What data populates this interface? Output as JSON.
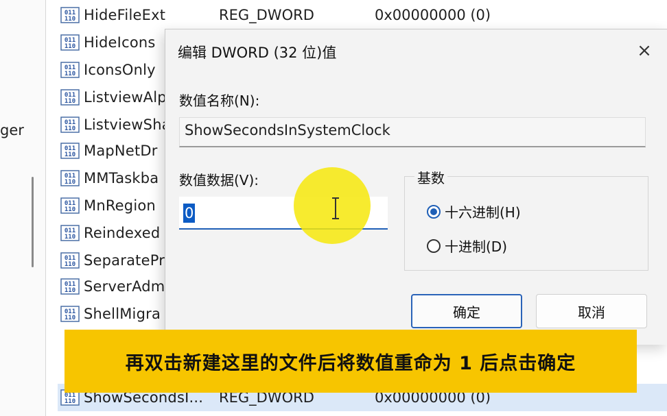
{
  "tree": {
    "fragment": "ger"
  },
  "values": [
    {
      "name": "HideFileExt",
      "type": "REG_DWORD",
      "data": "0x00000000 (0)"
    },
    {
      "name": "HideIcons",
      "type": "",
      "data": ""
    },
    {
      "name": "IconsOnly",
      "type": "",
      "data": ""
    },
    {
      "name": "ListviewAlp",
      "type": "",
      "data": ""
    },
    {
      "name": "ListviewSha",
      "type": "",
      "data": ""
    },
    {
      "name": "MapNetDr",
      "type": "",
      "data": ""
    },
    {
      "name": "MMTaskba",
      "type": "",
      "data": ""
    },
    {
      "name": "MnRegion",
      "type": "",
      "data": ""
    },
    {
      "name": "Reindexed",
      "type": "",
      "data": ""
    },
    {
      "name": "SeparatePr",
      "type": "",
      "data": ""
    },
    {
      "name": "ServerAdm",
      "type": "",
      "data": ""
    },
    {
      "name": "ShellMigra",
      "type": "",
      "data": ""
    },
    {
      "name": "ShowSecondsI...",
      "type": "REG_DWORD",
      "data": "0x00000000 (0)"
    }
  ],
  "dialog": {
    "title": "编辑 DWORD (32 位)值",
    "close_icon": "×",
    "name_label": "数值名称(N):",
    "name_value": "ShowSecondsInSystemClock",
    "data_label": "数值数据(V):",
    "data_value": "0",
    "base_label": "基数",
    "base_options": [
      {
        "label": "十六进制(H)",
        "selected": true
      },
      {
        "label": "十进制(D)",
        "selected": false
      }
    ],
    "ok_label": "确定",
    "cancel_label": "取消"
  },
  "caption": "再双击新建这里的文件后将数值重命为 1 后点击确定",
  "colors": {
    "highlight": "#f6e80a",
    "caption_bg": "#f7c500",
    "accent": "#1f5fb6"
  }
}
